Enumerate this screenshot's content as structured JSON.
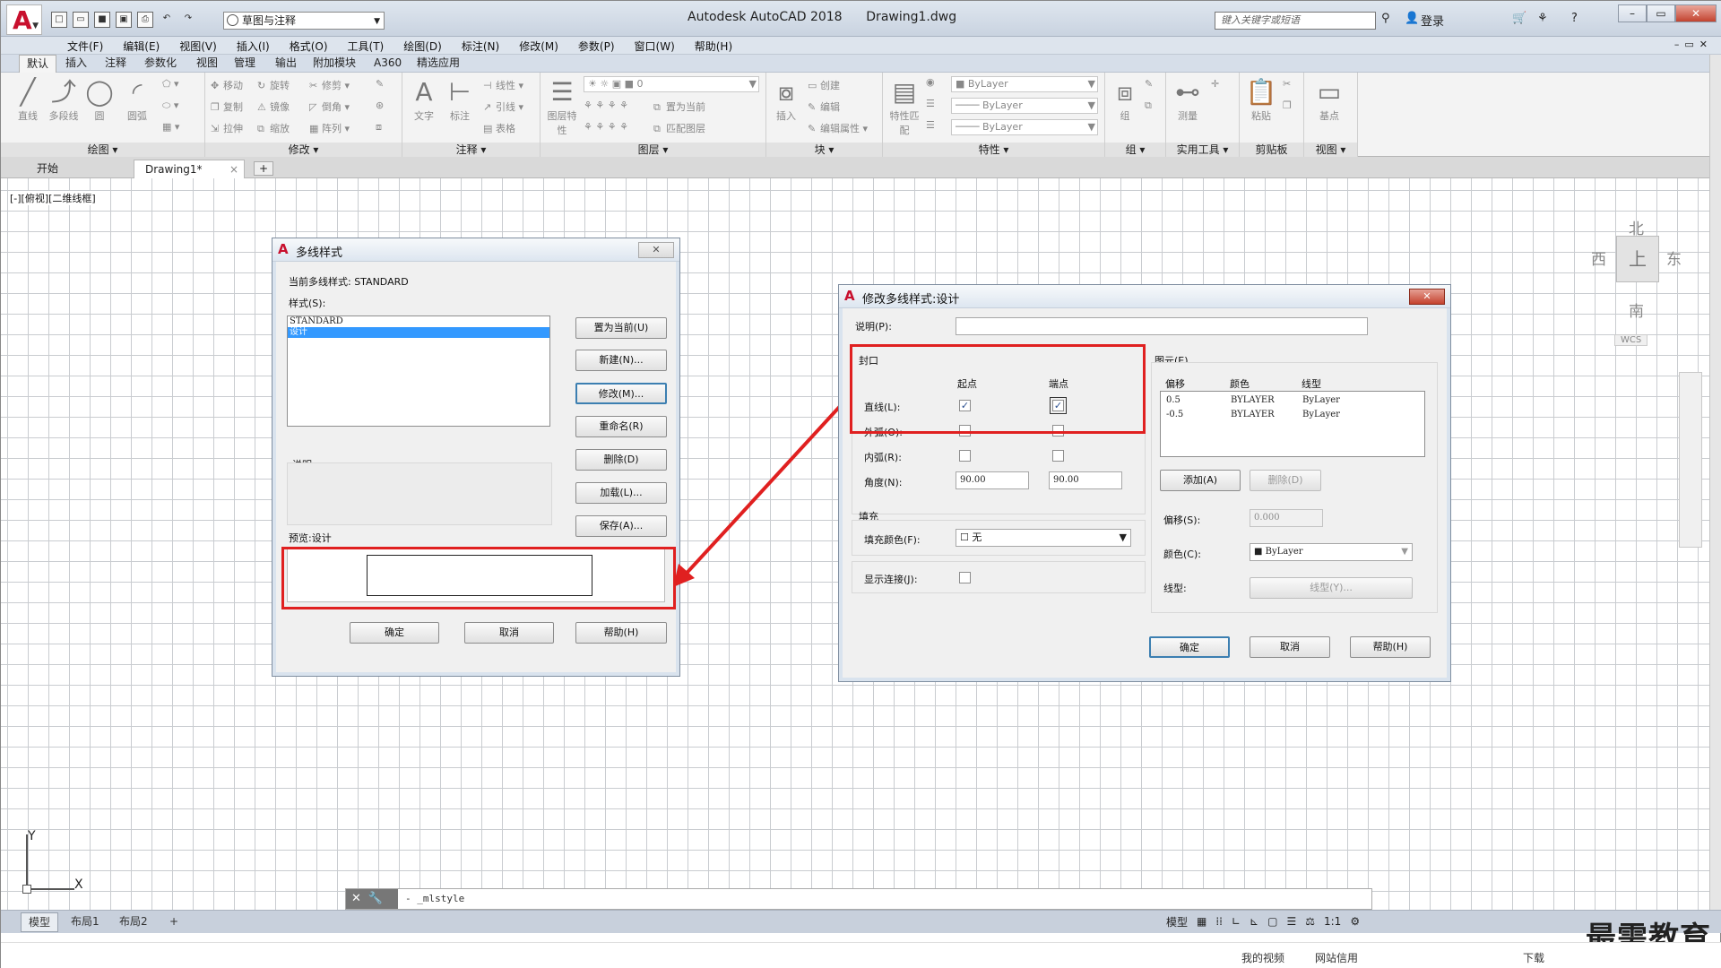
{
  "app": {
    "title": "Autodesk AutoCAD 2018",
    "file": "Drawing1.dwg",
    "workspace": "草图与注释",
    "search_placeholder": "键入关键字或短语",
    "login": "登录"
  },
  "menu": [
    "文件(F)",
    "编辑(E)",
    "视图(V)",
    "插入(I)",
    "格式(O)",
    "工具(T)",
    "绘图(D)",
    "标注(N)",
    "修改(M)",
    "参数(P)",
    "窗口(W)",
    "帮助(H)"
  ],
  "ribbon_tabs": [
    "默认",
    "插入",
    "注释",
    "参数化",
    "视图",
    "管理",
    "输出",
    "附加模块",
    "A360",
    "精选应用"
  ],
  "ribbon": {
    "draw": {
      "title": "绘图",
      "items": [
        "直线",
        "多段线",
        "圆",
        "圆弧"
      ]
    },
    "modify": {
      "title": "修改",
      "items": [
        "移动",
        "旋转",
        "修剪",
        "复制",
        "镜像",
        "倒角",
        "拉伸",
        "缩放",
        "阵列"
      ]
    },
    "annotate": {
      "title": "注释",
      "items": [
        "文字",
        "标注",
        "线性",
        "引线",
        "表格"
      ]
    },
    "layers": {
      "title": "图层",
      "items": [
        "图层特性",
        "置为当前",
        "匹配图层"
      ],
      "layer_value": "0"
    },
    "block": {
      "title": "块",
      "items": [
        "插入",
        "创建",
        "编辑",
        "编辑属性"
      ]
    },
    "properties": {
      "title": "特性",
      "items": [
        "特性匹配",
        "ByLayer",
        "ByLayer",
        "ByLayer"
      ]
    },
    "groups": {
      "title": "组",
      "items": [
        "组"
      ]
    },
    "utilities": {
      "title": "实用工具",
      "items": [
        "测量"
      ]
    },
    "clipboard": {
      "title": "剪贴板",
      "items": [
        "粘贴"
      ]
    },
    "view": {
      "title": "视图",
      "items": [
        "基点"
      ]
    }
  },
  "file_tabs": [
    "开始",
    "Drawing1*"
  ],
  "viewport_label": "[-][俯视][二维线框]",
  "viewcube": {
    "north": "北",
    "south": "南",
    "east": "东",
    "west": "西",
    "face": "上",
    "wcs": "WCS"
  },
  "ucs": {
    "x": "X",
    "y": "Y"
  },
  "command_line": "- _mlstyle",
  "layout_tabs": [
    "模型",
    "布局1",
    "布局2"
  ],
  "status": {
    "model": "模型",
    "scale": "1:1"
  },
  "watermark": "最需教育",
  "taskbar": [
    "我的视频",
    "网站信用",
    "下载"
  ],
  "dlg_mlstyle": {
    "title": "多线样式",
    "current_label": "当前多线样式: STANDARD",
    "styles_label": "样式(S):",
    "styles": [
      "STANDARD",
      "设计"
    ],
    "desc_label": "说明:",
    "preview_label": "预览:设计",
    "buttons": [
      "置为当前(U)",
      "新建(N)...",
      "修改(M)...",
      "重命名(R)",
      "删除(D)",
      "加载(L)...",
      "保存(A)..."
    ],
    "ok": "确定",
    "cancel": "取消",
    "help": "帮助(H)"
  },
  "dlg_modify": {
    "title": "修改多线样式:设计",
    "desc_label": "说明(P):",
    "caps": {
      "title": "封口",
      "start": "起点",
      "end": "端点",
      "rows": [
        {
          "label": "直线(L):",
          "start": true,
          "end": true
        },
        {
          "label": "外弧(O):",
          "start": false,
          "end": false
        },
        {
          "label": "内弧(R):",
          "start": false,
          "end": false
        }
      ],
      "angle_label": "角度(N):",
      "angle_start": "90.00",
      "angle_end": "90.00"
    },
    "fill": {
      "title": "填充",
      "color_label": "填充颜色(F):",
      "color_value": "无"
    },
    "joints_label": "显示连接(J):",
    "elements": {
      "title": "图元(E)",
      "headers": [
        "偏移",
        "颜色",
        "线型"
      ],
      "rows": [
        {
          "offset": "0.5",
          "color": "BYLAYER",
          "ltype": "ByLayer"
        },
        {
          "offset": "-0.5",
          "color": "BYLAYER",
          "ltype": "ByLayer"
        }
      ],
      "add": "添加(A)",
      "delete": "删除(D)",
      "offset_label": "偏移(S):",
      "offset_value": "0.000",
      "color_label": "颜色(C):",
      "color_value": "ByLayer",
      "ltype_label": "线型:",
      "ltype_btn": "线型(Y)..."
    },
    "ok": "确定",
    "cancel": "取消",
    "help": "帮助(H)"
  },
  "colors": {
    "highlight": "#e02020",
    "selection": "#3399ff",
    "brand": "#c8102e"
  }
}
